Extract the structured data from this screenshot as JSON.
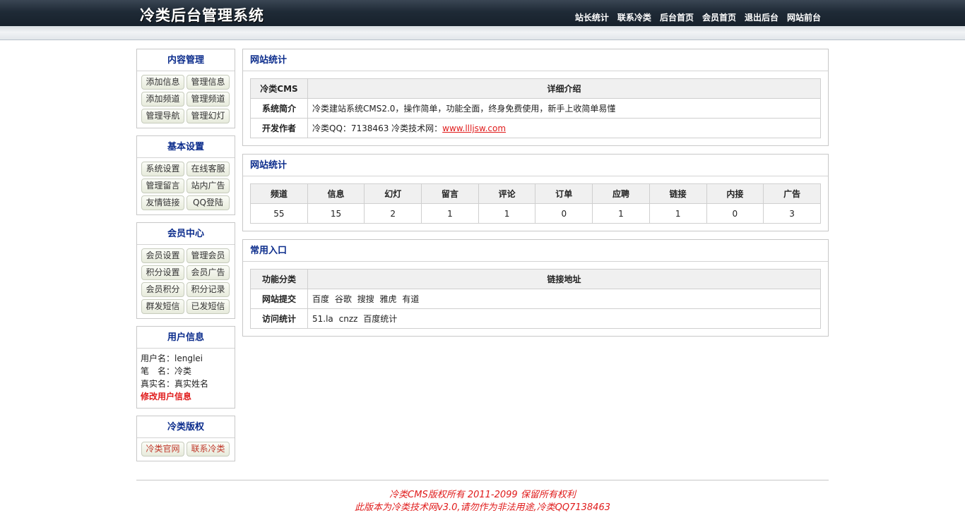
{
  "header": {
    "title": "冷类后台管理系统",
    "nav": [
      "站长统计",
      "联系冷类",
      "后台首页",
      "会员首页",
      "退出后台",
      "网站前台"
    ]
  },
  "sidebar": {
    "content": {
      "title": "内容管理",
      "buttons": [
        "添加信息",
        "管理信息",
        "添加频道",
        "管理频道",
        "管理导航",
        "管理幻灯"
      ]
    },
    "basic": {
      "title": "基本设置",
      "buttons": [
        "系统设置",
        "在线客服",
        "管理留言",
        "站内广告",
        "友情链接",
        "QQ登陆"
      ]
    },
    "member": {
      "title": "会员中心",
      "buttons": [
        "会员设置",
        "管理会员",
        "积分设置",
        "会员广告",
        "会员积分",
        "积分记录",
        "群发短信",
        "已发短信"
      ]
    },
    "user": {
      "title": "用户信息",
      "username": "用户名：lenglei",
      "nickname": "笔　名：冷类",
      "realname": "真实名：真实姓名",
      "edit": "修改用户信息"
    },
    "copyright": {
      "title": "冷类版权",
      "buttons": [
        "冷类官网",
        "联系冷类"
      ]
    }
  },
  "panels": {
    "info": {
      "title": "网站统计",
      "head_key": "冷类CMS",
      "head_val": "详细介绍",
      "intro_key": "系统简介",
      "intro_val": "冷类建站系统CMS2.0，操作简单，功能全面，终身免费使用，新手上收简单易懂",
      "author_key": "开发作者",
      "author_val": "冷类QQ：7138463 冷类技术网：",
      "author_link": "www.llljsw.com"
    },
    "stats": {
      "title": "网站统计",
      "headers": [
        "频道",
        "信息",
        "幻灯",
        "留言",
        "评论",
        "订单",
        "应聘",
        "链接",
        "内接",
        "广告"
      ],
      "values": [
        "55",
        "15",
        "2",
        "1",
        "1",
        "0",
        "1",
        "1",
        "0",
        "3"
      ]
    },
    "entry": {
      "title": "常用入口",
      "head_key": "功能分类",
      "head_val": "链接地址",
      "submit_key": "网站提交",
      "submit_links": [
        "百度",
        "谷歌",
        "搜搜",
        "雅虎",
        "有道"
      ],
      "stat_key": "访问统计",
      "stat_links": [
        "51.la",
        "cnzz",
        "百度统计"
      ]
    }
  },
  "footer": {
    "line1": "冷类CMS版权所有 2011-2099 保留所有权利",
    "line2": "此版本为冷类技术网v3.0,请勿作为非法用途,冷类QQ7138463"
  }
}
